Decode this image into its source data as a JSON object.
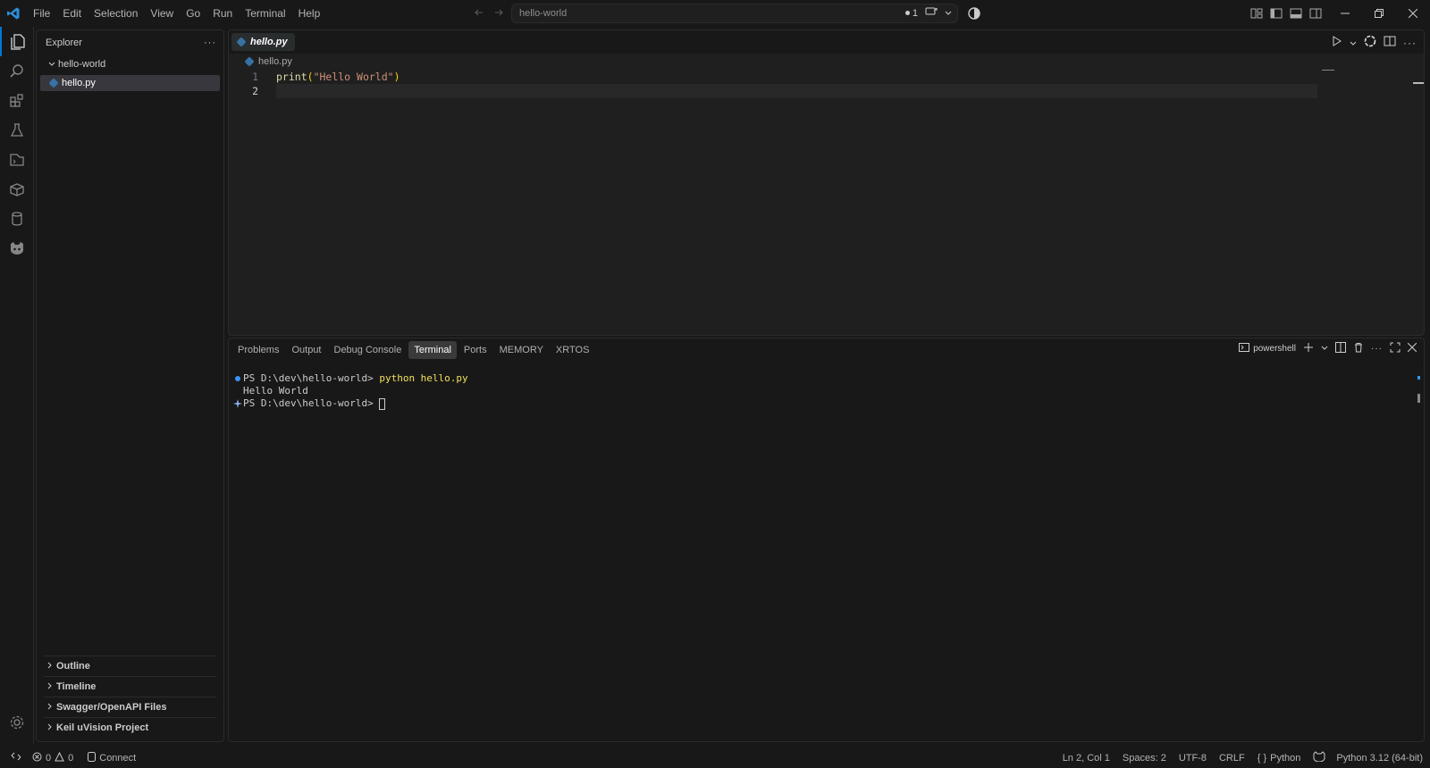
{
  "menu": [
    "File",
    "Edit",
    "Selection",
    "View",
    "Go",
    "Run",
    "Terminal",
    "Help"
  ],
  "command_center": {
    "text": "hello-world",
    "badge": "1"
  },
  "activity": [
    "explorer-icon",
    "search-icon",
    "extensions-icon",
    "testing-icon",
    "remote-explorer-icon",
    "containers-icon",
    "database-icon",
    "copilot-icon",
    "settings-gear-icon"
  ],
  "sidebar": {
    "title": "Explorer",
    "folder": "hello-world",
    "file": "hello.py",
    "sections": [
      "Outline",
      "Timeline",
      "Swagger/OpenAPI Files",
      "Keil uVision Project"
    ]
  },
  "editor": {
    "tab_label": "hello.py",
    "breadcrumb": "hello.py",
    "lines": [
      {
        "number": "1",
        "fn": "print",
        "open": "(",
        "str": "\"Hello World\"",
        "close": ")"
      },
      {
        "number": "2"
      }
    ]
  },
  "panel": {
    "tabs": [
      "Problems",
      "Output",
      "Debug Console",
      "Terminal",
      "Ports",
      "MEMORY",
      "XRTOS"
    ],
    "active_tab": "Terminal",
    "shell": "powershell",
    "terminal": {
      "prompt1": "PS D:\\dev\\hello-world> ",
      "command": "python hello.py",
      "output": "Hello World",
      "prompt2": "PS D:\\dev\\hello-world> "
    }
  },
  "status": {
    "errors": "0",
    "warnings": "0",
    "connect": "Connect",
    "position": "Ln 2, Col 1",
    "spaces": "Spaces: 2",
    "encoding": "UTF-8",
    "eol": "CRLF",
    "language": "Python",
    "interpreter": "Python 3.12 (64-bit)"
  },
  "colors": {
    "accent": "#0078d4",
    "background": "#181818",
    "editor": "#1f1f1f"
  }
}
